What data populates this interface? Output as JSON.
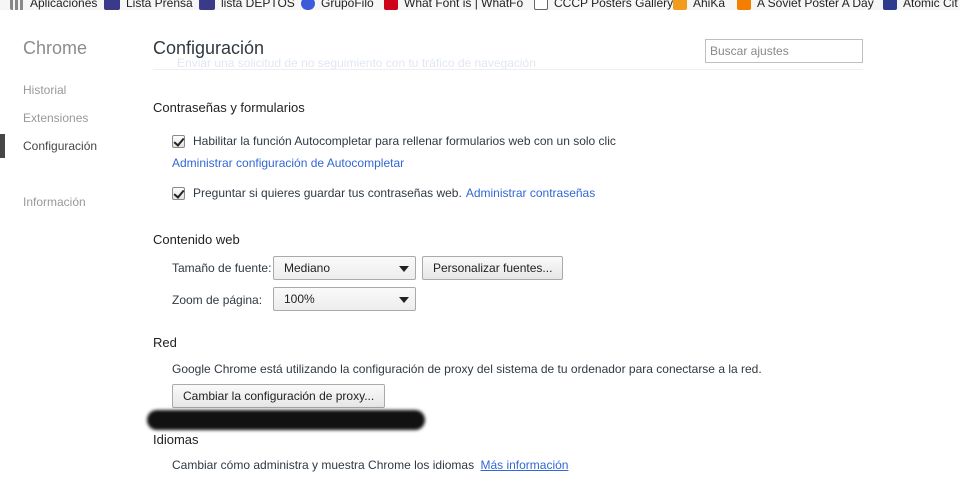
{
  "bookmarks": [
    {
      "label": "Aplicaciones",
      "icon": "apps-icon"
    },
    {
      "label": "Lista Prensa",
      "icon": "mail-icon"
    },
    {
      "label": "lista DEPTOS",
      "icon": "mail-icon"
    },
    {
      "label": "GrupoFilo",
      "icon": "grupo-icon"
    },
    {
      "label": "What Font is | WhatFo",
      "icon": "whatfont-icon"
    },
    {
      "label": "CCCP Posters Gallery",
      "icon": "page-icon"
    },
    {
      "label": "AhiKa",
      "icon": "ahika-icon"
    },
    {
      "label": "A Soviet Poster A Day",
      "icon": "blogger-icon"
    },
    {
      "label": "Atomic Cit",
      "icon": "atomic-icon"
    }
  ],
  "sidebar": {
    "title": "Chrome",
    "items": [
      {
        "label": "Historial"
      },
      {
        "label": "Extensiones"
      },
      {
        "label": "Configuración",
        "selected": true
      },
      {
        "label": "Información"
      }
    ]
  },
  "header": {
    "title": "Configuración",
    "search_placeholder": "Buscar ajustes",
    "ghost_text": "Enviar una solicitud de no seguimiento con tu tráfico de navegación"
  },
  "passwords": {
    "title": "Contraseñas y formularios",
    "autofill_label": "Habilitar la función Autocompletar para rellenar formularios web con un solo clic",
    "autofill_checked": true,
    "autofill_link": "Administrar configuración de Autocompletar",
    "save_passwords_label": "Preguntar si quieres guardar tus contraseñas web.",
    "save_passwords_checked": true,
    "manage_passwords_link": "Administrar contraseñas"
  },
  "web_content": {
    "title": "Contenido web",
    "font_size_label": "Tamaño de fuente:",
    "font_size_value": "Mediano",
    "customize_fonts_button": "Personalizar fuentes...",
    "zoom_label": "Zoom de página:",
    "zoom_value": "100%"
  },
  "network": {
    "title": "Red",
    "description": "Google Chrome está utilizando la configuración de proxy del sistema de tu ordenador para conectarse a la red.",
    "proxy_button": "Cambiar la configuración de proxy..."
  },
  "languages": {
    "title": "Idiomas",
    "description": "Cambiar cómo administra y muestra Chrome los idiomas",
    "more_info_link": "Más información"
  }
}
